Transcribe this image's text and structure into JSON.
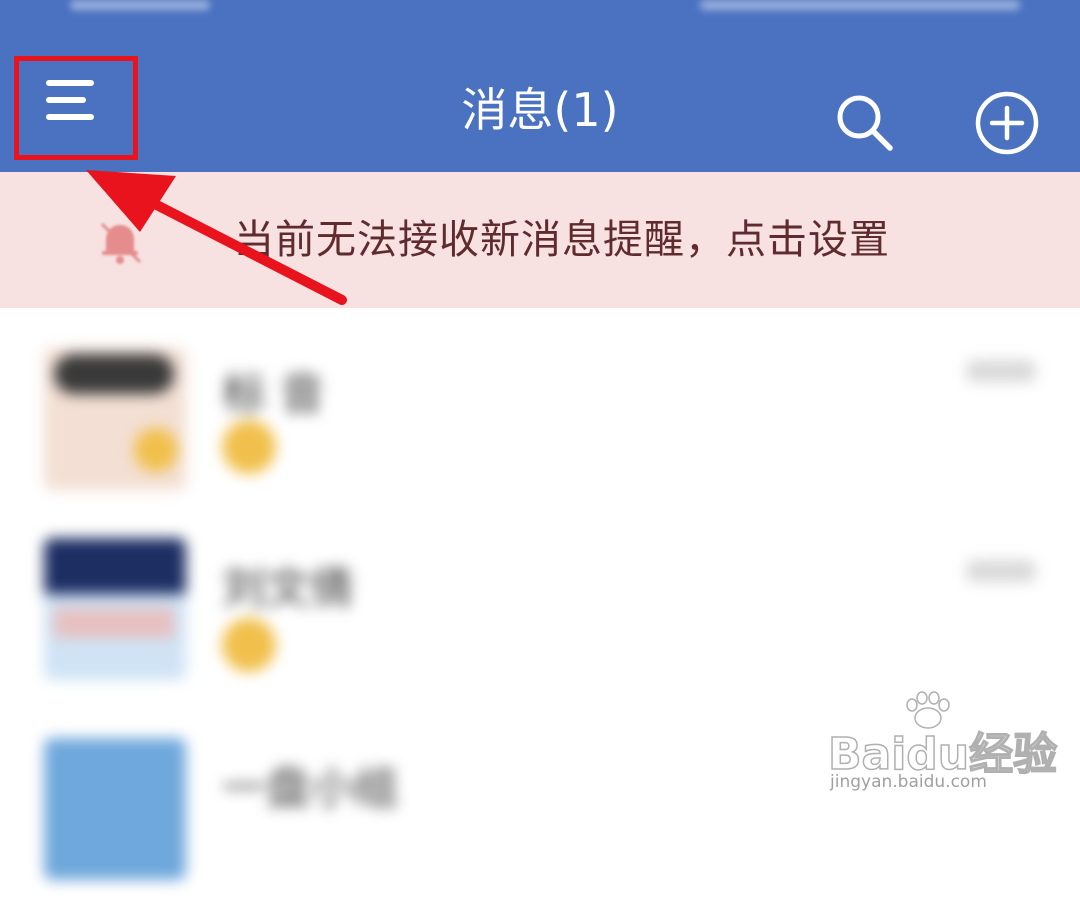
{
  "header": {
    "title": "消息(1)",
    "menu_icon": "menu-icon",
    "search_icon": "search-icon",
    "add_icon": "plus-circle-icon"
  },
  "notice": {
    "text": "当前无法接收新消息提醒，点击设置",
    "icon": "bell-off-icon"
  },
  "conversations": [
    {
      "name": "标 音"
    },
    {
      "name": "刘文倩"
    },
    {
      "name": "一盘小组"
    }
  ],
  "watermark": {
    "main": "Baidu经验",
    "sub": "jingyan.baidu.com"
  },
  "colors": {
    "header_bg": "#4a72c1",
    "notice_bg": "#f7e1e1",
    "notice_text": "#5f2b2e",
    "highlight": "#e8131c"
  }
}
